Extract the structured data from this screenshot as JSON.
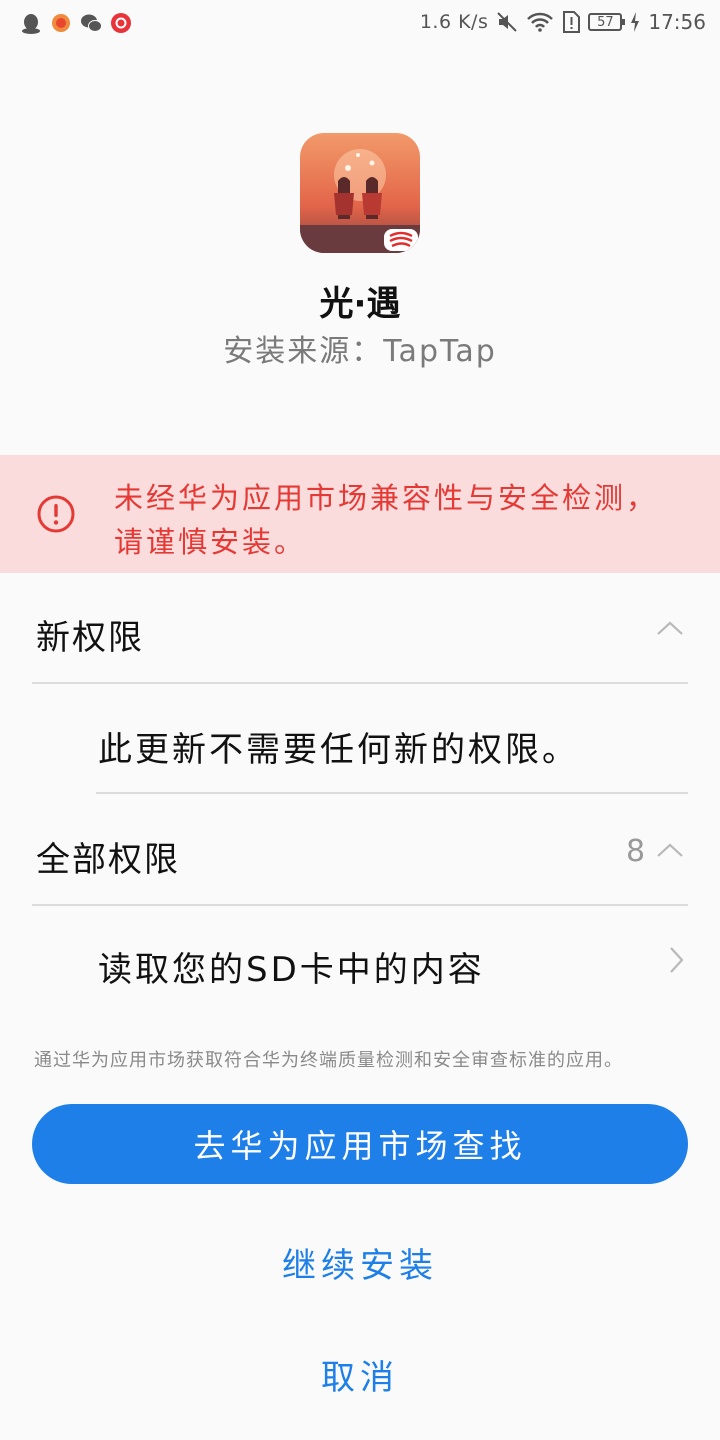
{
  "status_bar": {
    "speed": "1.6 K/s",
    "battery": "57",
    "time": "17:56",
    "icons": [
      "qq-icon",
      "netease-icon",
      "wechat-icon",
      "netease-music-icon",
      "speed-icon",
      "mute-icon",
      "wifi-icon",
      "sim-alert-icon",
      "battery-icon",
      "charging-icon"
    ]
  },
  "app": {
    "name": "光·遇",
    "source": "安装来源：TapTap"
  },
  "warning": {
    "text": "未经华为应用市场兼容性与安全检测，请谨慎安装。",
    "color": "#e53935"
  },
  "new_permissions": {
    "title": "新权限",
    "item": "此更新不需要任何新的权限。"
  },
  "all_permissions": {
    "title": "全部权限",
    "count": "8",
    "item": "读取您的SD卡中的内容"
  },
  "footnote": "通过华为应用市场获取符合华为终端质量检测和安全审查标准的应用。",
  "buttons": {
    "market": "去华为应用市场查找",
    "continue": "继续安装",
    "cancel": "取消"
  },
  "colors": {
    "accent": "#1e7fe8",
    "warning_bg": "#fbdcdc"
  }
}
